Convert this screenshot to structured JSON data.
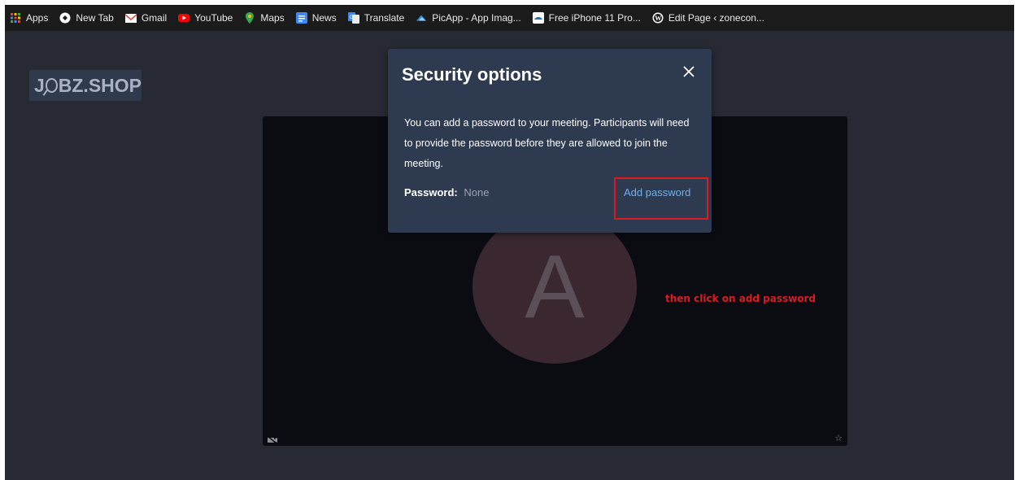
{
  "bookmarks": [
    {
      "label": "Apps",
      "icon": "apps-grid-icon"
    },
    {
      "label": "New Tab",
      "icon": "new-tab-icon"
    },
    {
      "label": "Gmail",
      "icon": "gmail-icon"
    },
    {
      "label": "YouTube",
      "icon": "youtube-icon"
    },
    {
      "label": "Maps",
      "icon": "maps-pin-icon"
    },
    {
      "label": "News",
      "icon": "news-icon"
    },
    {
      "label": "Translate",
      "icon": "translate-icon"
    },
    {
      "label": "PicApp - App Imag...",
      "icon": "picapp-icon"
    },
    {
      "label": "Free iPhone 11 Pro...",
      "icon": "iphone-site-icon"
    },
    {
      "label": "Edit Page ‹ zonecon...",
      "icon": "wordpress-icon"
    }
  ],
  "logo": {
    "before": "J",
    "after": "BZ.SHOP"
  },
  "video": {
    "avatar_letter": "A",
    "camera_icon": "camera-off-icon",
    "star_icon": "star-icon",
    "star": "☆"
  },
  "dialog": {
    "title": "Security options",
    "close_icon": "close-icon",
    "description": "You can add a password to your meeting. Participants will need to provide the password before they are allowed to join the meeting.",
    "password_label": "Password:",
    "password_value": "None",
    "add_password": "Add password"
  },
  "annotation": {
    "text": "then click on add password",
    "color": "#e0191c"
  },
  "colors": {
    "stage": "#272a33",
    "dialog": "#2d3a4f",
    "link": "#6eb3f2",
    "video": "#0a0c12"
  }
}
